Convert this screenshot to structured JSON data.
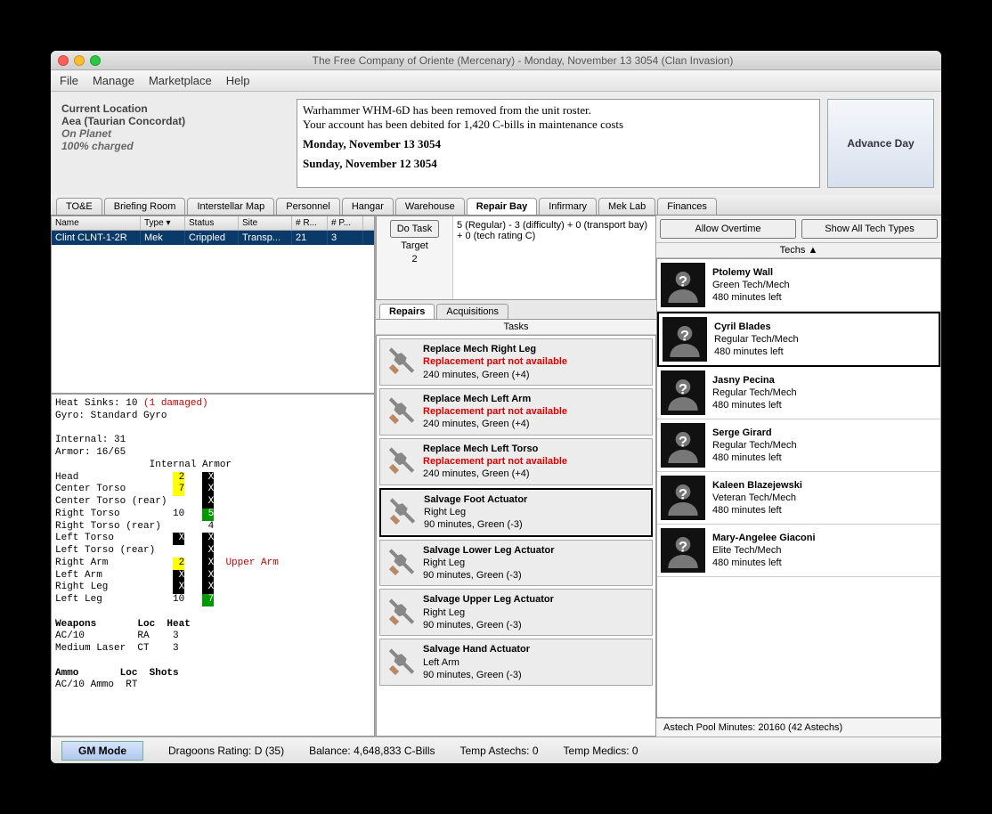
{
  "window": {
    "title": "The Free Company of Oriente (Mercenary) - Monday, November 13 3054 (Clan Invasion)"
  },
  "menubar": [
    "File",
    "Manage",
    "Marketplace",
    "Help"
  ],
  "location": {
    "label": "Current Location",
    "planet": "Aea (Taurian Concordat)",
    "status": "On Planet",
    "charge": "100% charged"
  },
  "log": {
    "line1": "Warhammer WHM-6D has been removed from the unit roster.",
    "line2": "Your account has been debited for 1,420 C-bills in maintenance costs",
    "date1": "Monday, November 13 3054",
    "date2": "Sunday, November 12 3054"
  },
  "advance_label": "Advance Day",
  "main_tabs": [
    "TO&E",
    "Briefing Room",
    "Interstellar Map",
    "Personnel",
    "Hangar",
    "Warehouse",
    "Repair Bay",
    "Infirmary",
    "Mek Lab",
    "Finances"
  ],
  "active_main_tab": "Repair Bay",
  "unit_columns": [
    "Name",
    "Type",
    "Status",
    "Site",
    "# R...",
    "# P..."
  ],
  "unit_row": {
    "name": "Clint CLNT-1-2R",
    "type": "Mek",
    "status": "Crippled",
    "site": "Transp...",
    "r": "21",
    "p": "3"
  },
  "detail_text": {
    "l1": "Heat Sinks: 10 ",
    "l1d": "(1 damaged)",
    "l2": "Gyro: Standard Gyro",
    "l3": "Internal: 31",
    "l4": "Armor: 16/65",
    "hdr": "                Internal Armor",
    "rows": [
      {
        "loc": "Head",
        "i": "2",
        "iy": true,
        "a": "X",
        "ab": true
      },
      {
        "loc": "Center Torso",
        "i": "7",
        "iy": true,
        "a": "X",
        "ab": true
      },
      {
        "loc": "Center Torso (rear)",
        "i": "",
        "a": "X",
        "ab": true
      },
      {
        "loc": "Right Torso",
        "i": "10",
        "a": "5",
        "ag": true
      },
      {
        "loc": "Right Torso (rear)",
        "i": "",
        "a": "4"
      },
      {
        "loc": "Left Torso",
        "i": "X",
        "ib": true,
        "a": "X",
        "ab": true
      },
      {
        "loc": "Left Torso (rear)",
        "i": "",
        "a": "X",
        "ab": true
      },
      {
        "loc": "Right Arm",
        "i": "2",
        "iy": true,
        "a": "X",
        "ab": true,
        "extra": "Upper Arm"
      },
      {
        "loc": "Left Arm",
        "i": "X",
        "ib": true,
        "a": "X",
        "ab": true
      },
      {
        "loc": "Right Leg",
        "i": "X",
        "ib": true,
        "a": "X",
        "ab": true
      },
      {
        "loc": "Left Leg",
        "i": "10",
        "a": "7",
        "ag": true
      }
    ],
    "weapons_hdr": "Weapons       Loc  Heat",
    "w1": "AC/10         RA    3",
    "w2": "Medium Laser  CT    3",
    "ammo_hdr": "Ammo       Loc  Shots",
    "a1": "AC/10 Ammo  RT"
  },
  "dotask": {
    "btn": "Do Task",
    "target_label": "Target",
    "target_val": "2"
  },
  "calc_text": "5 (Regular) - 3 (difficulty) + 0 (transport bay) + 0 (tech rating C)",
  "sub_tabs": [
    "Repairs",
    "Acquisitions"
  ],
  "tasks_header": "Tasks",
  "tasks": [
    {
      "t1": "Replace Mech Right Leg",
      "warn": "Replacement part not available",
      "t3": "240 minutes, Green (+4)"
    },
    {
      "t1": "Replace Mech Left Arm",
      "warn": "Replacement part not available",
      "t3": "240 minutes, Green (+4)"
    },
    {
      "t1": "Replace Mech Left Torso",
      "warn": "Replacement part not available",
      "t3": "240 minutes, Green (+4)"
    },
    {
      "t1": "Salvage Foot Actuator",
      "t2": "Right Leg",
      "t3": "90 minutes, Green (-3)",
      "selected": true
    },
    {
      "t1": "Salvage Lower Leg Actuator",
      "t2": "Right Leg",
      "t3": "90 minutes, Green (-3)"
    },
    {
      "t1": "Salvage Upper Leg Actuator",
      "t2": "Right Leg",
      "t3": "90 minutes, Green (-3)"
    },
    {
      "t1": "Salvage Hand Actuator",
      "t2": "Left Arm",
      "t3": "90 minutes, Green (-3)"
    }
  ],
  "tech_buttons": {
    "overtime": "Allow Overtime",
    "showall": "Show All Tech Types"
  },
  "techs_header": "Techs ▲",
  "techs": [
    {
      "name": "Ptolemy Wall",
      "skill": "Green Tech/Mech",
      "time": "480 minutes left"
    },
    {
      "name": "Cyril Blades",
      "skill": "Regular Tech/Mech",
      "time": "480 minutes left",
      "selected": true
    },
    {
      "name": "Jasny Pecina",
      "skill": "Regular Tech/Mech",
      "time": "480 minutes left"
    },
    {
      "name": "Serge Girard",
      "skill": "Regular Tech/Mech",
      "time": "480 minutes left"
    },
    {
      "name": "Kaleen Blazejewski",
      "skill": "Veteran Tech/Mech",
      "time": "480 minutes left"
    },
    {
      "name": "Mary-Angelee Giaconi",
      "skill": "Elite Tech/Mech",
      "time": "480 minutes left"
    }
  ],
  "astech_line": "Astech Pool Minutes: 20160 (42 Astechs)",
  "statusbar": {
    "gm": "GM Mode",
    "dragoons": "Dragoons Rating: D (35)",
    "balance": "Balance: 4,648,833 C-Bills",
    "astechs": "Temp Astechs: 0",
    "medics": "Temp Medics: 0"
  }
}
